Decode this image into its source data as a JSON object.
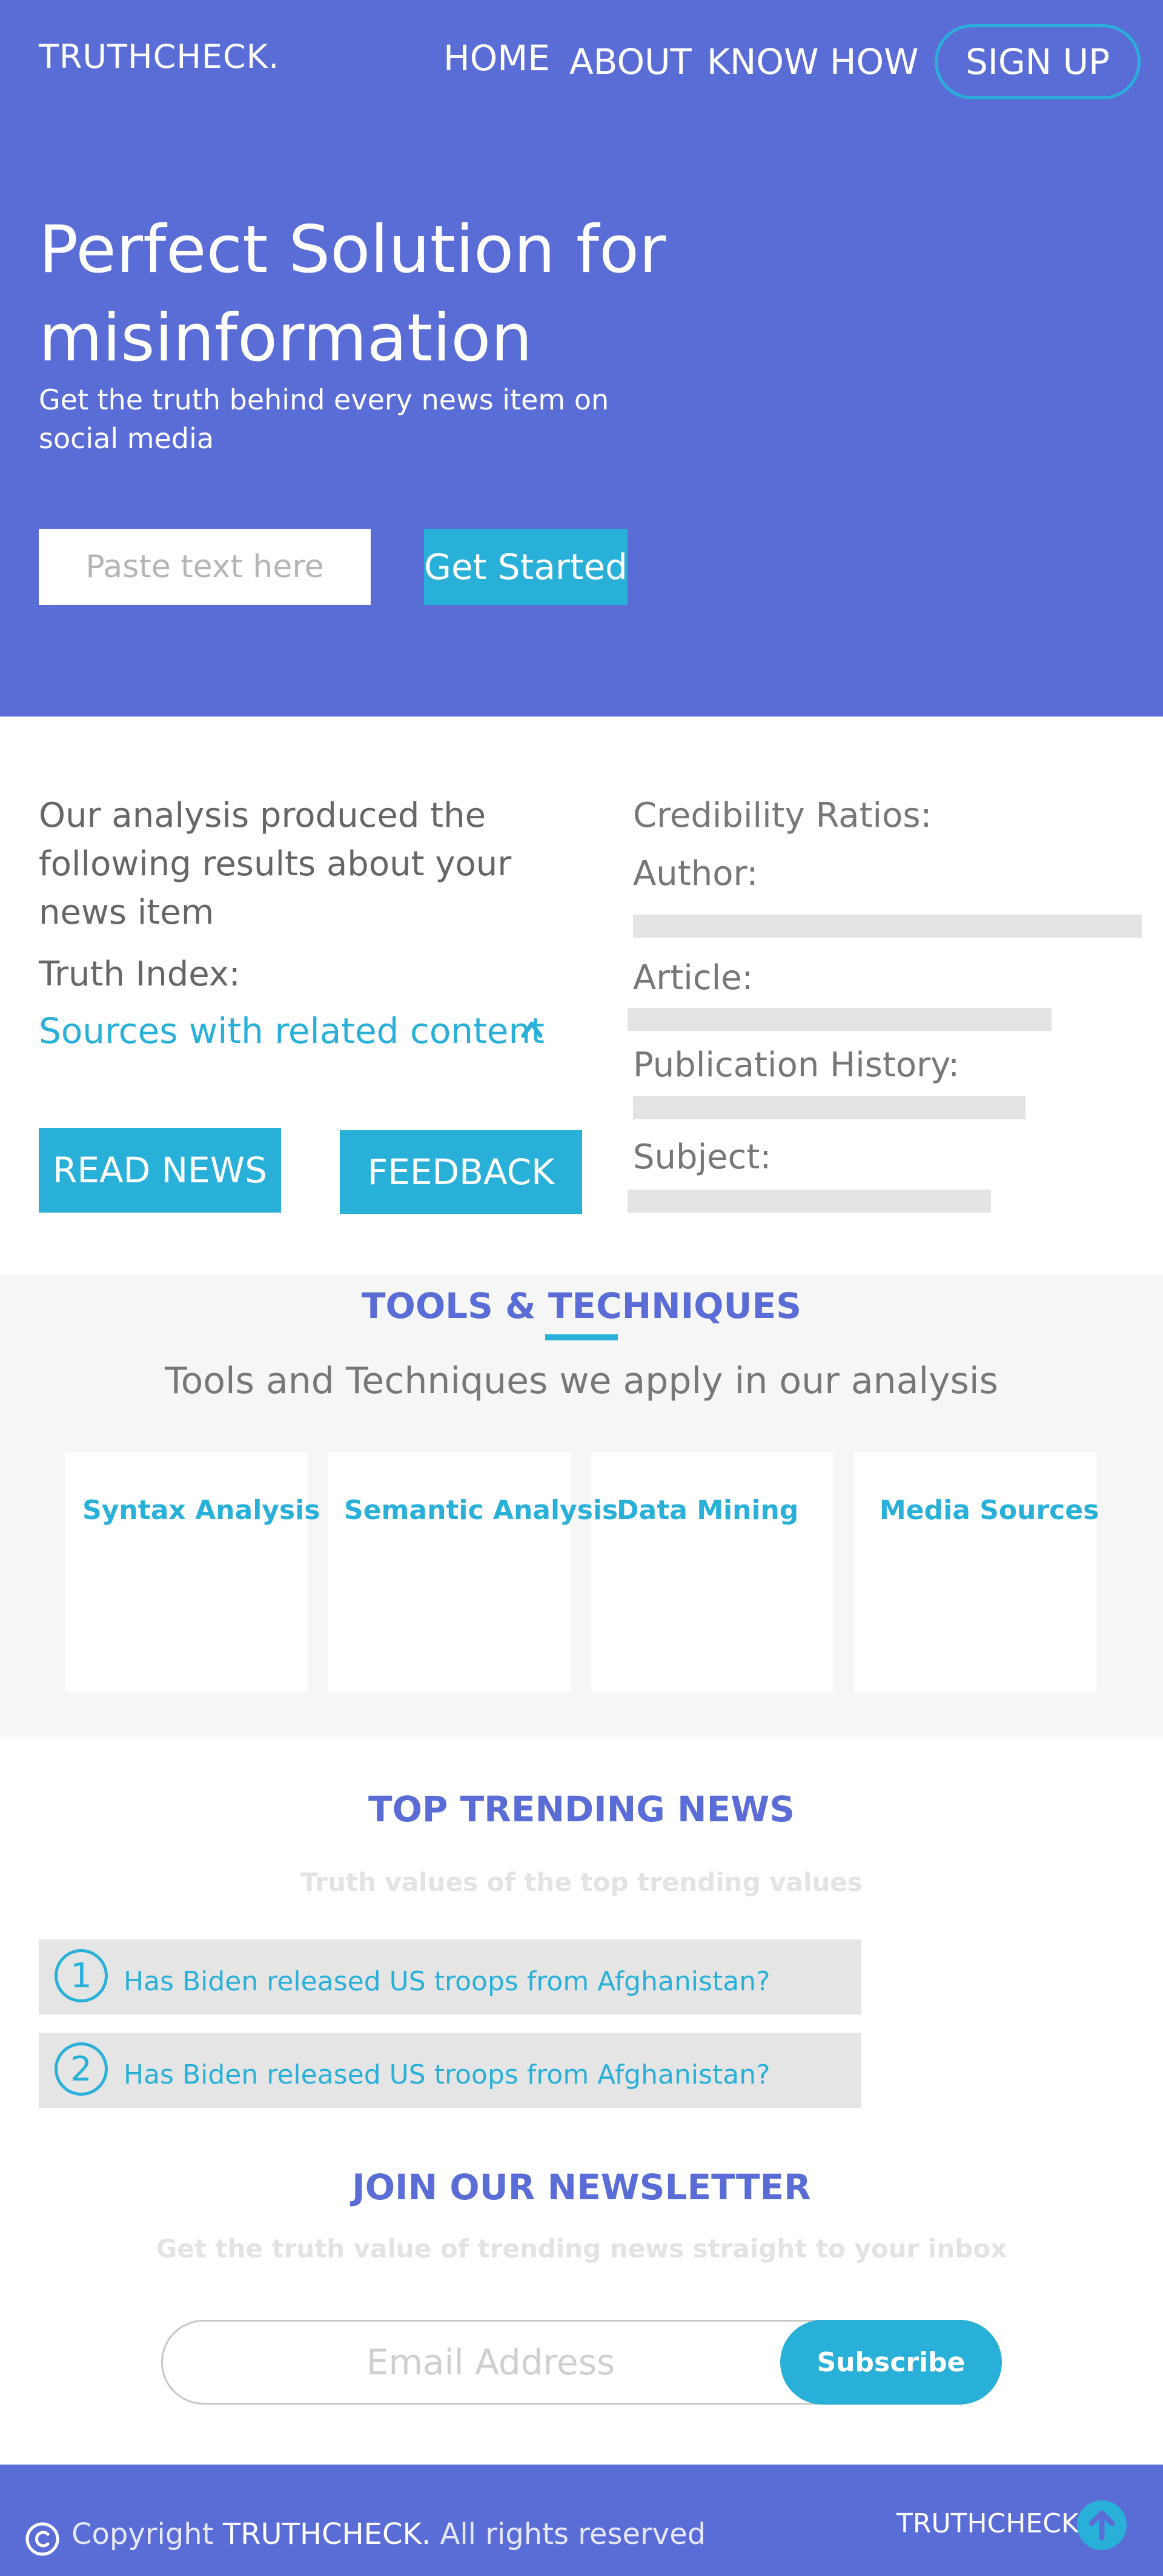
{
  "header": {
    "logo": "TRUTHCHECK.",
    "nav": [
      "HOME",
      "ABOUT",
      "KNOW HOW"
    ],
    "signup_label": "SIGN UP"
  },
  "hero": {
    "title": "Perfect Solution for misinformation",
    "subtitle": "Get the truth behind every news item on social media",
    "input_placeholder": "Paste text here",
    "cta_label": "Get Started"
  },
  "results": {
    "intro": "Our analysis produced the following results about your news item",
    "truth_index_label": "Truth Index:",
    "sources_link": "Sources with related content",
    "read_news_label": "READ NEWS",
    "feedback_label": "FEEDBACK"
  },
  "credibility": {
    "title": "Credibility Ratios:",
    "items": [
      {
        "label": "Author:"
      },
      {
        "label": "Article:"
      },
      {
        "label": "Publication History:"
      },
      {
        "label": "Subject:"
      }
    ]
  },
  "tools": {
    "title": "TOOLS & TECHNIQUES",
    "subtitle": "Tools and Techniques we apply in our analysis",
    "cards": [
      {
        "name": "Syntax Analysis"
      },
      {
        "name": "Semantic Analysis"
      },
      {
        "name": "Data Mining"
      },
      {
        "name": "Media Sources"
      }
    ]
  },
  "trending": {
    "title": "TOP TRENDING NEWS",
    "subtitle": "Truth values of the top trending values",
    "items": [
      {
        "rank": "1",
        "text": "Has Biden released US troops from Afghanistan?"
      },
      {
        "rank": "2",
        "text": "Has Biden released US troops from Afghanistan?"
      }
    ]
  },
  "newsletter": {
    "title": "JOIN OUR NEWSLETTER",
    "subtitle": "Get the truth value of trending news straight to your inbox",
    "email_placeholder": "Email Address",
    "subscribe_label": "Subscribe"
  },
  "footer": {
    "copyright_prefix": "Copyright",
    "copyright_brand": "TRUTHCHECK.",
    "copyright_suffix": "All rights reserved",
    "brand": "TRUTHCHECK"
  },
  "colors": {
    "primary": "#5a6cd6",
    "accent": "#29b0d9",
    "bar": "#e3e3e3",
    "muted_text": "#777777"
  }
}
